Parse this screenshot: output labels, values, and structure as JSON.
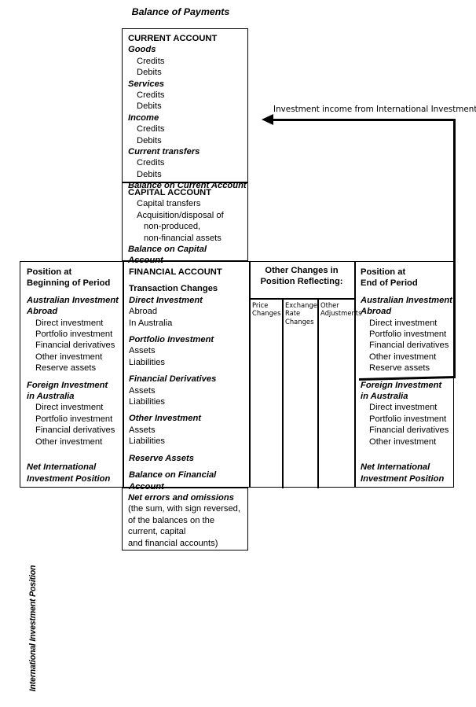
{
  "title": "Balance of Payments",
  "vertical_label": "International Investment Position",
  "arrow": {
    "label": "Investment income from International Investment",
    "icon": "left-arrow-icon",
    "direction": "left"
  },
  "current_account": {
    "heading": "CURRENT ACCOUNT",
    "items": [
      {
        "text": "Goods",
        "style": "ital",
        "indent": 0
      },
      {
        "text": "Credits",
        "style": "plain",
        "indent": 1
      },
      {
        "text": "Debits",
        "style": "plain",
        "indent": 1
      },
      {
        "text": "Services",
        "style": "ital",
        "indent": 0
      },
      {
        "text": "Credits",
        "style": "plain",
        "indent": 1
      },
      {
        "text": "Debits",
        "style": "plain",
        "indent": 1
      },
      {
        "text": "Income",
        "style": "ital",
        "indent": 0
      },
      {
        "text": "Credits",
        "style": "plain",
        "indent": 1
      },
      {
        "text": "Debits",
        "style": "plain",
        "indent": 1
      },
      {
        "text": "Current transfers",
        "style": "ital",
        "indent": 0
      },
      {
        "text": "Credits",
        "style": "plain",
        "indent": 1
      },
      {
        "text": "Debits",
        "style": "plain",
        "indent": 1
      },
      {
        "text": "Balance on Current Account",
        "style": "ital",
        "indent": 0
      }
    ]
  },
  "capital_account": {
    "heading": "CAPITAL ACCOUNT",
    "items": [
      {
        "text": "Capital transfers",
        "style": "plain",
        "indent": 1
      },
      {
        "text": "Acquisition/disposal of",
        "style": "plain",
        "indent": 1
      },
      {
        "text": "non-produced,",
        "style": "plain",
        "indent": 2
      },
      {
        "text": "non-financial assets",
        "style": "plain",
        "indent": 2
      },
      {
        "text": "Balance on Capital",
        "style": "ital",
        "indent": 0
      },
      {
        "text": " Account",
        "style": "ital",
        "indent": 0
      }
    ]
  },
  "financial_account": {
    "heading": "FINANCIAL ACCOUNT",
    "subheading": "Transaction Changes",
    "items": [
      {
        "text": "Direct Investment",
        "style": "ital",
        "indent": 0
      },
      {
        "text": "Abroad",
        "style": "plain",
        "indent": 0
      },
      {
        "text": "In Australia",
        "style": "plain",
        "indent": 0
      },
      {
        "text": "Portfolio Investment",
        "style": "ital",
        "indent": 0,
        "gap": true
      },
      {
        "text": "Assets",
        "style": "plain",
        "indent": 0
      },
      {
        "text": "Liabilities",
        "style": "plain",
        "indent": 0
      },
      {
        "text": "Financial Derivatives",
        "style": "ital",
        "indent": 0,
        "gap": true
      },
      {
        "text": "Assets",
        "style": "plain",
        "indent": 0
      },
      {
        "text": "Liabilities",
        "style": "plain",
        "indent": 0
      },
      {
        "text": "Other Investment",
        "style": "ital",
        "indent": 0,
        "gap": true
      },
      {
        "text": "Assets",
        "style": "plain",
        "indent": 0
      },
      {
        "text": "Liabilities",
        "style": "plain",
        "indent": 0
      },
      {
        "text": "Reserve Assets",
        "style": "ital",
        "indent": 0,
        "gap": true
      },
      {
        "text": "Balance on Financial",
        "style": "ital",
        "indent": 0,
        "gap": true
      },
      {
        "text": "Account",
        "style": "ital",
        "indent": 0
      }
    ]
  },
  "net_errors": {
    "heading": "Net errors and omissions",
    "lines": [
      "(the sum, with sign reversed,",
      "of the balances on the",
      "current, capital",
      "and financial accounts)"
    ]
  },
  "position_begin": {
    "heading_line1": "Position at",
    "heading_line2": "Beginning of Period",
    "items": [
      {
        "text": "Australian Investment",
        "style": "ital",
        "indent": 0,
        "gap": true
      },
      {
        "text": "Abroad",
        "style": "ital",
        "indent": 0
      },
      {
        "text": "Direct investment",
        "style": "plain",
        "indent": 1
      },
      {
        "text": "Portfolio investment",
        "style": "plain",
        "indent": 1
      },
      {
        "text": "Financial derivatives",
        "style": "plain",
        "indent": 1
      },
      {
        "text": "Other investment",
        "style": "plain",
        "indent": 1
      },
      {
        "text": "Reserve assets",
        "style": "plain",
        "indent": 1
      },
      {
        "text": "Foreign Investment",
        "style": "ital",
        "indent": 0,
        "gap": true
      },
      {
        "text": "in Australia",
        "style": "ital",
        "indent": 0
      },
      {
        "text": "Direct investment",
        "style": "plain",
        "indent": 1
      },
      {
        "text": "Portfolio investment",
        "style": "plain",
        "indent": 1
      },
      {
        "text": "Financial derivatives",
        "style": "plain",
        "indent": 1
      },
      {
        "text": "Other investment",
        "style": "plain",
        "indent": 1
      },
      {
        "text": "Net International",
        "style": "ital",
        "indent": 0,
        "gap2": true
      },
      {
        "text": "Investment Position",
        "style": "ital",
        "indent": 0
      }
    ]
  },
  "other_changes": {
    "title_line1": "Other Changes in",
    "title_line2": "Position Reflecting:",
    "columns": [
      {
        "lines": [
          "Price",
          "Changes"
        ]
      },
      {
        "lines": [
          "Exchange",
          "Rate",
          "Changes"
        ]
      },
      {
        "lines": [
          "Other",
          "Adjustments"
        ]
      }
    ]
  },
  "position_end": {
    "heading_line1": "Position at",
    "heading_line2": "End of Period",
    "items": [
      {
        "text": "Australian Investment",
        "style": "ital",
        "indent": 0,
        "gap": true
      },
      {
        "text": "Abroad",
        "style": "ital",
        "indent": 0
      },
      {
        "text": "Direct investment",
        "style": "plain",
        "indent": 1
      },
      {
        "text": "Portfolio investment",
        "style": "plain",
        "indent": 1
      },
      {
        "text": "Financial derivatives",
        "style": "plain",
        "indent": 1
      },
      {
        "text": "Other investment",
        "style": "plain",
        "indent": 1
      },
      {
        "text": "Reserve assets",
        "style": "plain",
        "indent": 1
      },
      {
        "text": "Foreign Investment",
        "style": "ital",
        "indent": 0,
        "gap": true
      },
      {
        "text": "in Australia",
        "style": "ital",
        "indent": 0
      },
      {
        "text": "Direct investment",
        "style": "plain",
        "indent": 1
      },
      {
        "text": "Portfolio investment",
        "style": "plain",
        "indent": 1
      },
      {
        "text": "Financial derivatives",
        "style": "plain",
        "indent": 1
      },
      {
        "text": "Other investment",
        "style": "plain",
        "indent": 1
      },
      {
        "text": "Net International",
        "style": "ital",
        "indent": 0,
        "gap2": true
      },
      {
        "text": "Investment Position",
        "style": "ital",
        "indent": 0
      }
    ]
  },
  "colors": {
    "line": "#000000",
    "background": "#ffffff"
  }
}
